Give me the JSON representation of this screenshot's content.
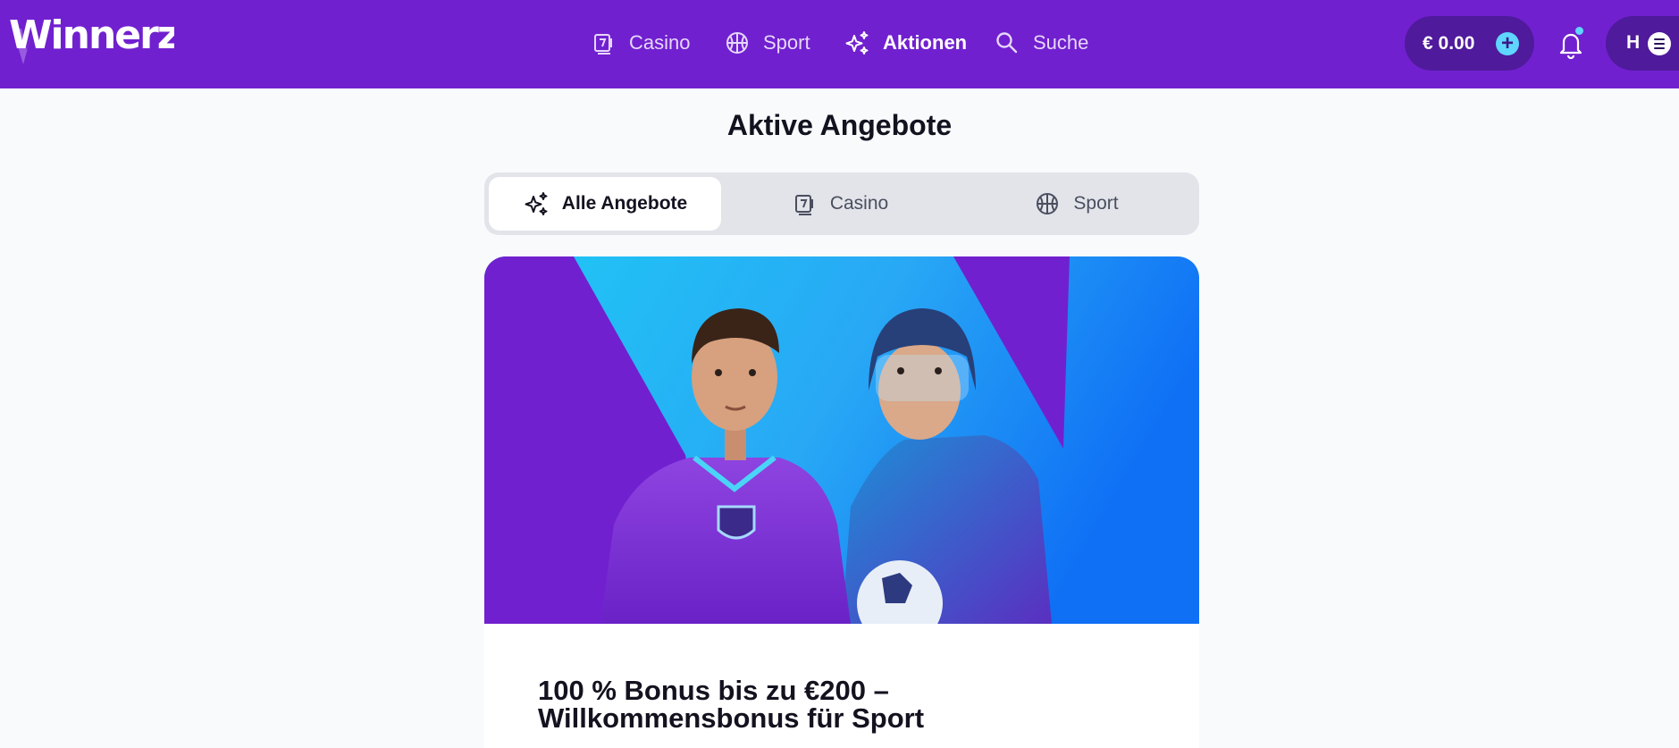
{
  "brand": {
    "logo_text": "Winnerz"
  },
  "nav": {
    "items": [
      {
        "label": "Casino",
        "icon": "slot-card-icon"
      },
      {
        "label": "Sport",
        "icon": "ball-icon"
      },
      {
        "label": "Aktionen",
        "icon": "sparkle-icon",
        "active": true
      },
      {
        "label": "Suche",
        "icon": "search-icon"
      }
    ]
  },
  "account": {
    "balance": "€ 0.00",
    "deposit_icon": "plus-icon",
    "notifications_icon": "bell-icon",
    "user_initial": "H",
    "menu_icon": "hamburger-icon"
  },
  "page": {
    "title": "Aktive Angebote"
  },
  "tabs": [
    {
      "label": "Alle Angebote",
      "icon": "sparkle-icon",
      "active": true
    },
    {
      "label": "Casino",
      "icon": "slot-card-icon"
    },
    {
      "label": "Sport",
      "icon": "ball-icon"
    }
  ],
  "promo": {
    "title": "100 % Bonus bis zu €200 – Willkommensbonus für Sport",
    "banner_image": "football and ice-hockey player illustration"
  },
  "colors": {
    "brand_purple": "#7120cf",
    "dark_purple": "#4f1a9b",
    "accent_cyan": "#5fd6ff",
    "page_bg": "#f8fafc",
    "tab_track": "#e2e4ea"
  }
}
